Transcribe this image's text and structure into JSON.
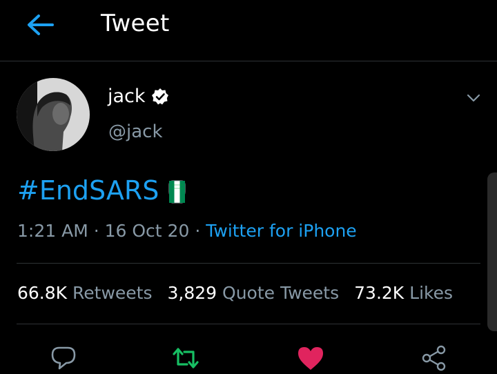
{
  "header": {
    "title": "Tweet"
  },
  "author": {
    "name": "jack",
    "handle": "@jack"
  },
  "tweet": {
    "text": "#EndSARS"
  },
  "meta": {
    "time": "1:21 AM",
    "date": "16 Oct 20",
    "source": "Twitter for iPhone"
  },
  "stats": {
    "retweets": "66.8K",
    "retweets_label": "Retweets",
    "quotes": "3,829",
    "quotes_label": "Quote Tweets",
    "likes": "73.2K",
    "likes_label": "Likes"
  },
  "icons": {
    "back": "arrow-left-icon",
    "verified": "verified-badge-icon",
    "more": "chevron-down-icon",
    "emoji": "raised-fist-nigeria-icon",
    "reply": "reply-icon",
    "retweet": "retweet-icon",
    "like": "heart-icon",
    "share": "share-icon"
  },
  "colors": {
    "accent": "#1da1f2",
    "retweet": "#17bf63",
    "like": "#e0245e",
    "background": "#000000"
  }
}
